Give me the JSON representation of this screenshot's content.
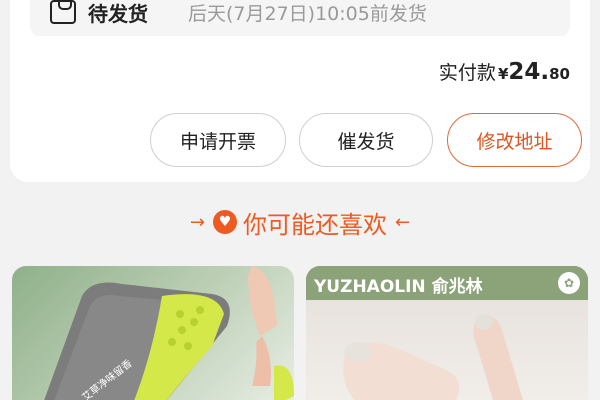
{
  "order": {
    "status_label": "待发货",
    "status_detail": "后天(7月27日)10:05前发货",
    "payment_label": "实付款",
    "currency_symbol": "¥",
    "amount_integer": "24.",
    "amount_decimal": "80"
  },
  "actions": {
    "invoice_label": "申请开票",
    "urge_label": "催发货",
    "change_address_label": "修改地址"
  },
  "recommend": {
    "title": "你可能还喜欢",
    "left_arrow": "→",
    "right_arrow": "←"
  },
  "products": [
    {
      "caption": "艾草净味留香",
      "image": "insole"
    },
    {
      "brand": "YUZHAOLIN 俞兆林",
      "image": "socks"
    }
  ],
  "colors": {
    "accent": "#ef5a22",
    "brand_green": "#8ca37a"
  }
}
